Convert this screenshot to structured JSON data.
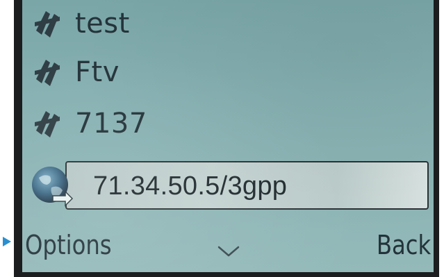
{
  "bookmarks": [
    {
      "label": "test",
      "icon": "bookmark-icon"
    },
    {
      "label": "Ftv",
      "icon": "bookmark-icon"
    },
    {
      "label": "7137",
      "icon": "bookmark-icon"
    }
  ],
  "address_bar": {
    "value": "71.34.50.5/3gpp",
    "icon": "globe-icon"
  },
  "softkeys": {
    "left_label": "Options",
    "center_icon": "chevron-down-icon",
    "right_label": "Back"
  },
  "colors": {
    "screen_bg": "#86b0b2",
    "text": "#24343a",
    "bezel": "#1b1d1f",
    "pointer_arrow": "#2a8fd0"
  }
}
